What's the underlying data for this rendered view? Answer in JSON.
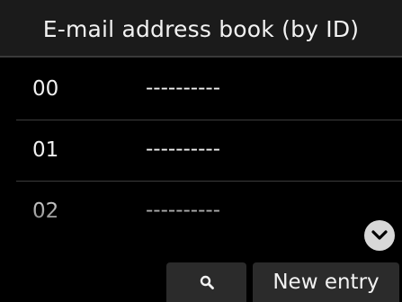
{
  "header": {
    "title": "E-mail address book (by ID)"
  },
  "entries": [
    {
      "id": "00",
      "value": "----------"
    },
    {
      "id": "01",
      "value": "----------"
    },
    {
      "id": "02",
      "value": "----------"
    }
  ],
  "scroll": {
    "icon": "chevron-down-icon"
  },
  "toolbar": {
    "search_icon": "search-icon",
    "new_entry_label": "New entry"
  },
  "colors": {
    "background": "#000000",
    "title_bar": "#1b1b1b",
    "button": "#2b2b2b",
    "scroll_button": "#d8d8d8"
  }
}
